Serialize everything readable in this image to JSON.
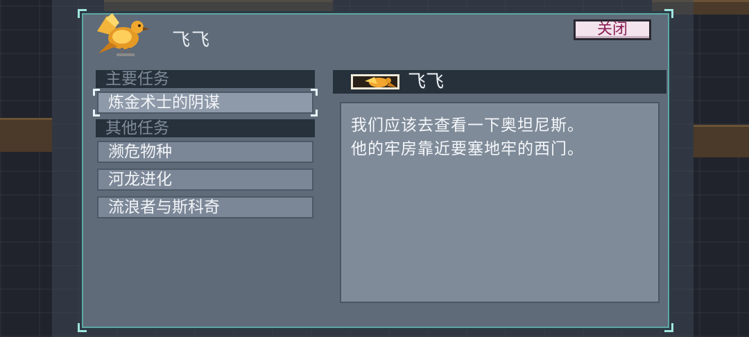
{
  "npc": {
    "name": "飞飞",
    "portrait_icon": "phoenix-bird-icon"
  },
  "buttons": {
    "close_label": "关闭"
  },
  "quests": {
    "main_label": "主要任务",
    "main_items": [
      {
        "label": "炼金术士的阴谋",
        "selected": true
      }
    ],
    "other_label": "其他任务",
    "other_items": [
      {
        "label": "濒危物种"
      },
      {
        "label": "河龙进化"
      },
      {
        "label": "流浪者与斯科奇"
      }
    ]
  },
  "dialogue": {
    "speaker_name": "飞飞",
    "lines": [
      "我们应该去查看一下奥坦尼斯。",
      "他的牢房靠近要塞地牢的西门。"
    ]
  },
  "colors": {
    "panel": "#5f6b79",
    "panel_dark": "#27313b",
    "close_text": "#8a1f57",
    "accent_border": "#5fa7a4"
  }
}
